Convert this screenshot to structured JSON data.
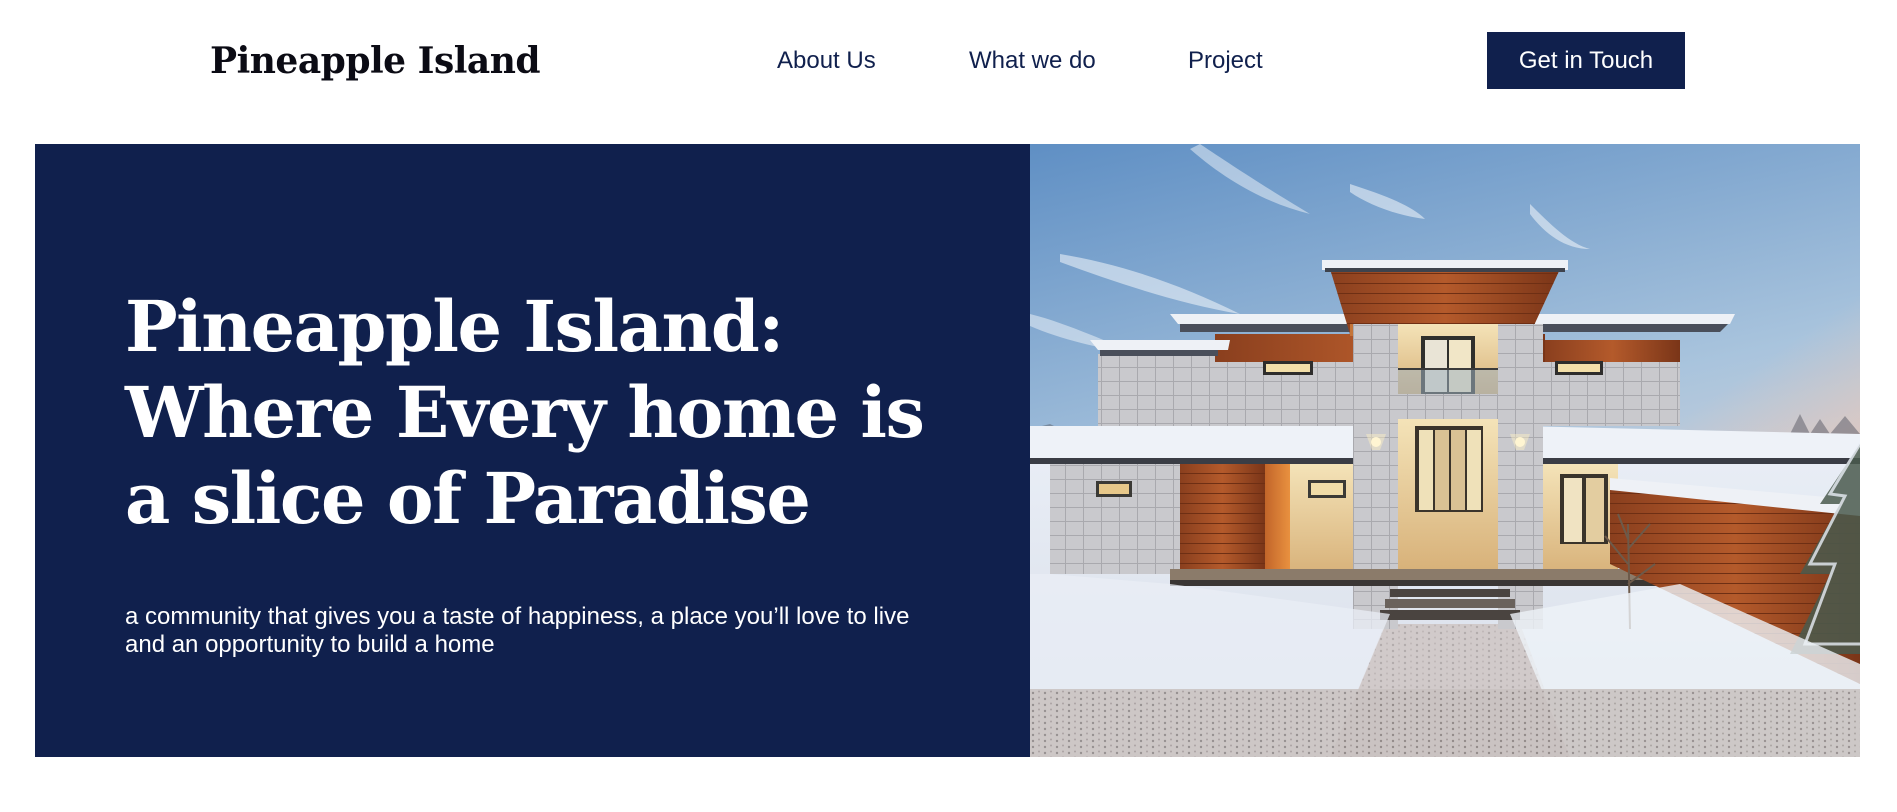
{
  "brand": {
    "name": "Pineapple Island"
  },
  "nav": {
    "items": [
      {
        "label": "About Us"
      },
      {
        "label": "What we do"
      },
      {
        "label": "Project"
      }
    ],
    "cta_label": "Get in Touch"
  },
  "hero": {
    "title_lines": [
      "Pineapple Island:",
      "Where Every home is",
      "a slice of Paradise"
    ],
    "subtitle": "a community that gives you a taste of happiness, a place you’ll love to live and an opportunity to build a home",
    "image": {
      "depicts": "modern-house-in-snow"
    }
  },
  "colors": {
    "navy": "#10204d",
    "white": "#ffffff",
    "logo_text": "#0b0b14"
  }
}
